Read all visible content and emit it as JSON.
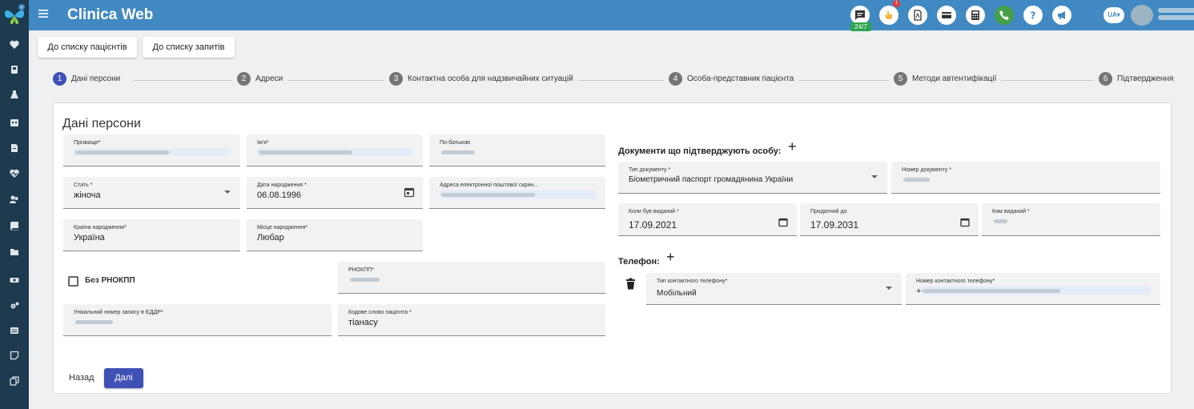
{
  "app": {
    "title": "Clinica Web",
    "support_badge": "24/7",
    "notifications_count": "1",
    "language": "UA"
  },
  "colors": {
    "topbar": "#4189c2",
    "sidebar": "#1d3a4f",
    "primary": "#3f51b5",
    "field_bg": "#f2f2f2"
  },
  "sidebar": {
    "icons": [
      "heart-icon",
      "badge-icon",
      "flask-icon",
      "calendar-icon",
      "document-icon",
      "heartbeat-icon",
      "users-icon",
      "book-icon",
      "folder-icon",
      "money-icon",
      "cogs-icon",
      "list-icon",
      "note-icon",
      "copy-icon"
    ]
  },
  "nav": {
    "to_patients": "До списку пацієнтів",
    "to_requests": "До списку запитів"
  },
  "steps": [
    {
      "num": "1",
      "label": "Дані персони"
    },
    {
      "num": "2",
      "label": "Адреси"
    },
    {
      "num": "3",
      "label": "Контактна особа для надзвичайних ситуацій"
    },
    {
      "num": "4",
      "label": "Особа-представник пацієнта"
    },
    {
      "num": "5",
      "label": "Методи автентифікації"
    },
    {
      "num": "6",
      "label": "Підтвердження"
    }
  ],
  "person": {
    "title": "Дані персони",
    "surname_label": "Прізвище*",
    "name_label": "Ім'я*",
    "patronymic_label": "По-батькові",
    "gender_label": "Стать *",
    "gender_value": "жіноча",
    "birthdate_label": "Дата народження *",
    "birthdate_value": "06.08.1996",
    "email_label": "Адреса електронної поштової скрин...",
    "country_label": "Країна народження*",
    "country_value": "Україна",
    "place_label": "Місце народження*",
    "place_value": "Любар",
    "no_rnokpp_label": "Без РНОКПП",
    "rnokpp_label": "РНОКПП*",
    "eddr_label": "Унікальний номер запису в ЄДДР*",
    "codeword_label": "Кодове слово пацієнта *",
    "codeword_value": "тіанасу"
  },
  "documents": {
    "title": "Документи що підтверджують особу:",
    "type_label": "Тип документу *",
    "type_value": "Біометричний паспорт громадянина України",
    "number_label": "Номер документу *",
    "issued_label": "Коли був виданий *",
    "issued_value": "17.09.2021",
    "valid_label": "Придатний до",
    "valid_value": "17.09.2031",
    "issuer_label": "Ким виданий *"
  },
  "phone": {
    "title": "Телефон:",
    "type_label": "Тип контактного телефону*",
    "type_value": "Мобільний",
    "number_label": "Номер контактного телефону*",
    "number_prefix": "+"
  },
  "actions": {
    "back": "Назад",
    "next": "Далі"
  }
}
